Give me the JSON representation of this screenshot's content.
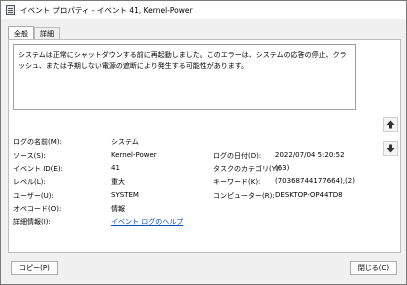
{
  "window": {
    "title": "イベント プロパティ - イベント 41, Kernel-Power"
  },
  "tabs": [
    {
      "label": "全般"
    },
    {
      "label": "詳細"
    }
  ],
  "message": "システムは正常にシャットダウンする前に再起動しました。このエラーは、システムの応答の停止、クラッシュ、または予期しない電源の遮断により発生する可能性があります。",
  "fields": {
    "log_name_label": "ログの名前(M):",
    "log_name_value": "システム",
    "source_label": "ソース(S):",
    "source_value": "Kernel-Power",
    "logged_label": "ログの日付(D):",
    "logged_value": "2022/07/04 5:20:52",
    "event_id_label": "イベント ID(E):",
    "event_id_value": "41",
    "task_category_label": "タスクのカテゴリ(Y):",
    "task_category_value": "(63)",
    "level_label": "レベル(L):",
    "level_value": "重大",
    "keywords_label": "キーワード(K):",
    "keywords_value": "(70368744177664),(2)",
    "user_label": "ユーザー(U):",
    "user_value": "SYSTEM",
    "computer_label": "コンピューター(R):",
    "computer_value": "DESKTOP-OP44TD8",
    "opcode_label": "オペコード(O):",
    "opcode_value": "情報",
    "more_info_label": "詳細情報(I):",
    "more_info_link": "イベント ログのヘルプ"
  },
  "buttons": {
    "copy": "コピー(P)",
    "close": "閉じる(C)"
  },
  "icons": {
    "app": "event-viewer-icon",
    "up": "up-arrow-icon",
    "down": "down-arrow-icon"
  }
}
